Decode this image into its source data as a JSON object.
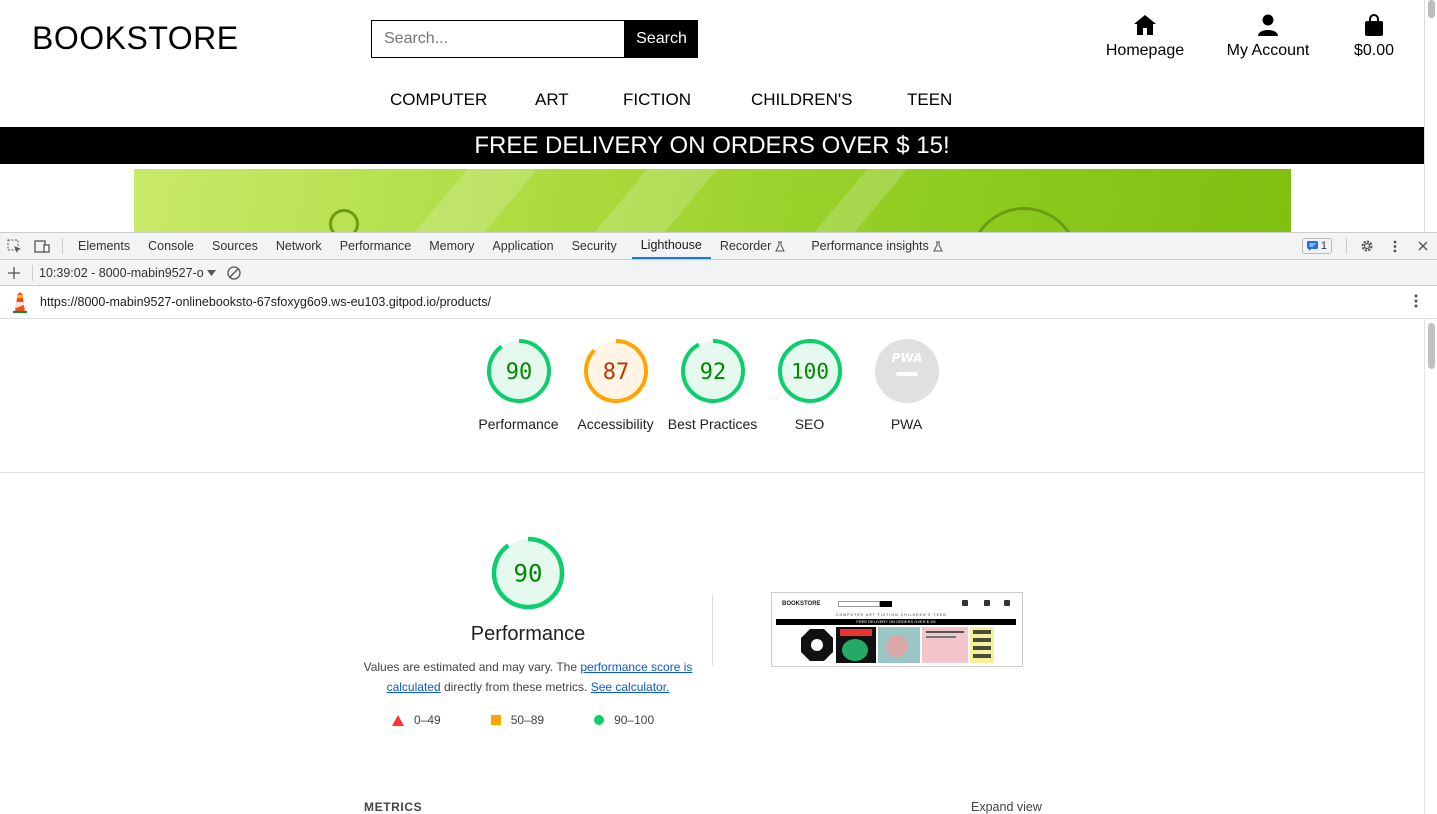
{
  "site": {
    "logo": "BOOKSTORE",
    "search_placeholder": "Search...",
    "search_button": "Search",
    "nav": {
      "home": "Homepage",
      "account": "My Account",
      "bag": "$0.00"
    },
    "categories": [
      "COMPUTER",
      "ART",
      "FICTION",
      "CHILDREN'S",
      "TEEN"
    ],
    "banner": "FREE DELIVERY ON ORDERS OVER $ 15!"
  },
  "devtools": {
    "tabs": [
      "Elements",
      "Console",
      "Sources",
      "Network",
      "Performance",
      "Memory",
      "Application",
      "Security",
      "Lighthouse",
      "Recorder",
      "Performance insights"
    ],
    "active_tab": "Lighthouse",
    "issues_count": "1",
    "report_select": "10:39:02 - 8000-mabin9527-o",
    "url": "https://8000-mabin9527-onlinebooksto-67sfoxyg6o9.ws-eu103.gitpod.io/products/"
  },
  "scores": [
    {
      "label": "Performance",
      "value": "90",
      "fraction": 0.9,
      "color": "#0cce6b",
      "text_color": "#008800",
      "fill": "#e6f9ee"
    },
    {
      "label": "Accessibility",
      "value": "87",
      "fraction": 0.87,
      "color": "#ffa400",
      "text_color": "#c33300",
      "fill": "#fff5e5"
    },
    {
      "label": "Best Practices",
      "value": "92",
      "fraction": 0.92,
      "color": "#0cce6b",
      "text_color": "#008800",
      "fill": "#e6f9ee"
    },
    {
      "label": "SEO",
      "value": "100",
      "fraction": 1.0,
      "color": "#0cce6b",
      "text_color": "#008800",
      "fill": "#e6f9ee"
    },
    {
      "label": "PWA",
      "value": "PWA",
      "fraction": 0,
      "color": "#e0e0e0",
      "text_color": "#ffffff",
      "fill": "#e0e0e0"
    }
  ],
  "performance": {
    "score": "90",
    "fraction": 0.9,
    "title": "Performance",
    "desc_pre": "Values are estimated and may vary. The ",
    "desc_link": "performance score is calculated",
    "desc_mid": " directly from these metrics. ",
    "desc_link2": "See calculator.",
    "legend": [
      {
        "range": "0–49",
        "color": "#ff3333",
        "shape": "triangle"
      },
      {
        "range": "50–89",
        "color": "#ffa400",
        "shape": "square"
      },
      {
        "range": "90–100",
        "color": "#0cce6b",
        "shape": "circle"
      }
    ]
  },
  "thumbnail": {
    "logo": "BOOKSTORE",
    "banner": "FREE DELIVERY ON ORDERS OVER $ 15!",
    "categories": "COMPUTER   ART   FICTION   CHILDREN'S   TEEN"
  },
  "metrics": {
    "heading": "METRICS",
    "expand": "Expand view"
  }
}
